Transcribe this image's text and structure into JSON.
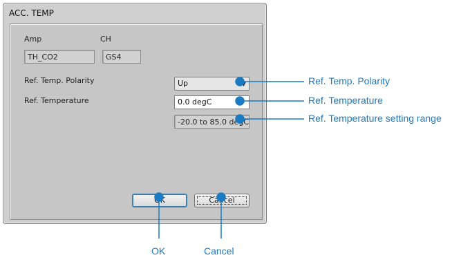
{
  "dialog": {
    "title": "ACC. TEMP",
    "amp_label": "Amp",
    "ch_label": "CH",
    "amp_value": "TH_CO2",
    "ch_value": "GS4",
    "polarity_label": "Ref. Temp. Polarity",
    "polarity_value": "Up",
    "temperature_label": "Ref. Temperature",
    "temperature_value": "0.0 degC",
    "range_value": "-20.0 to 85.0 degC",
    "ok_label": "OK",
    "cancel_label": "Cancel"
  },
  "callouts": {
    "polarity": "Ref. Temp. Polarity",
    "temperature": "Ref. Temperature",
    "range": "Ref. Temperature setting range",
    "ok": "OK",
    "cancel": "Cancel"
  },
  "colors": {
    "accent": "#1a7ac2"
  },
  "icons": {
    "combo_arrow": "chevron-down-icon"
  }
}
